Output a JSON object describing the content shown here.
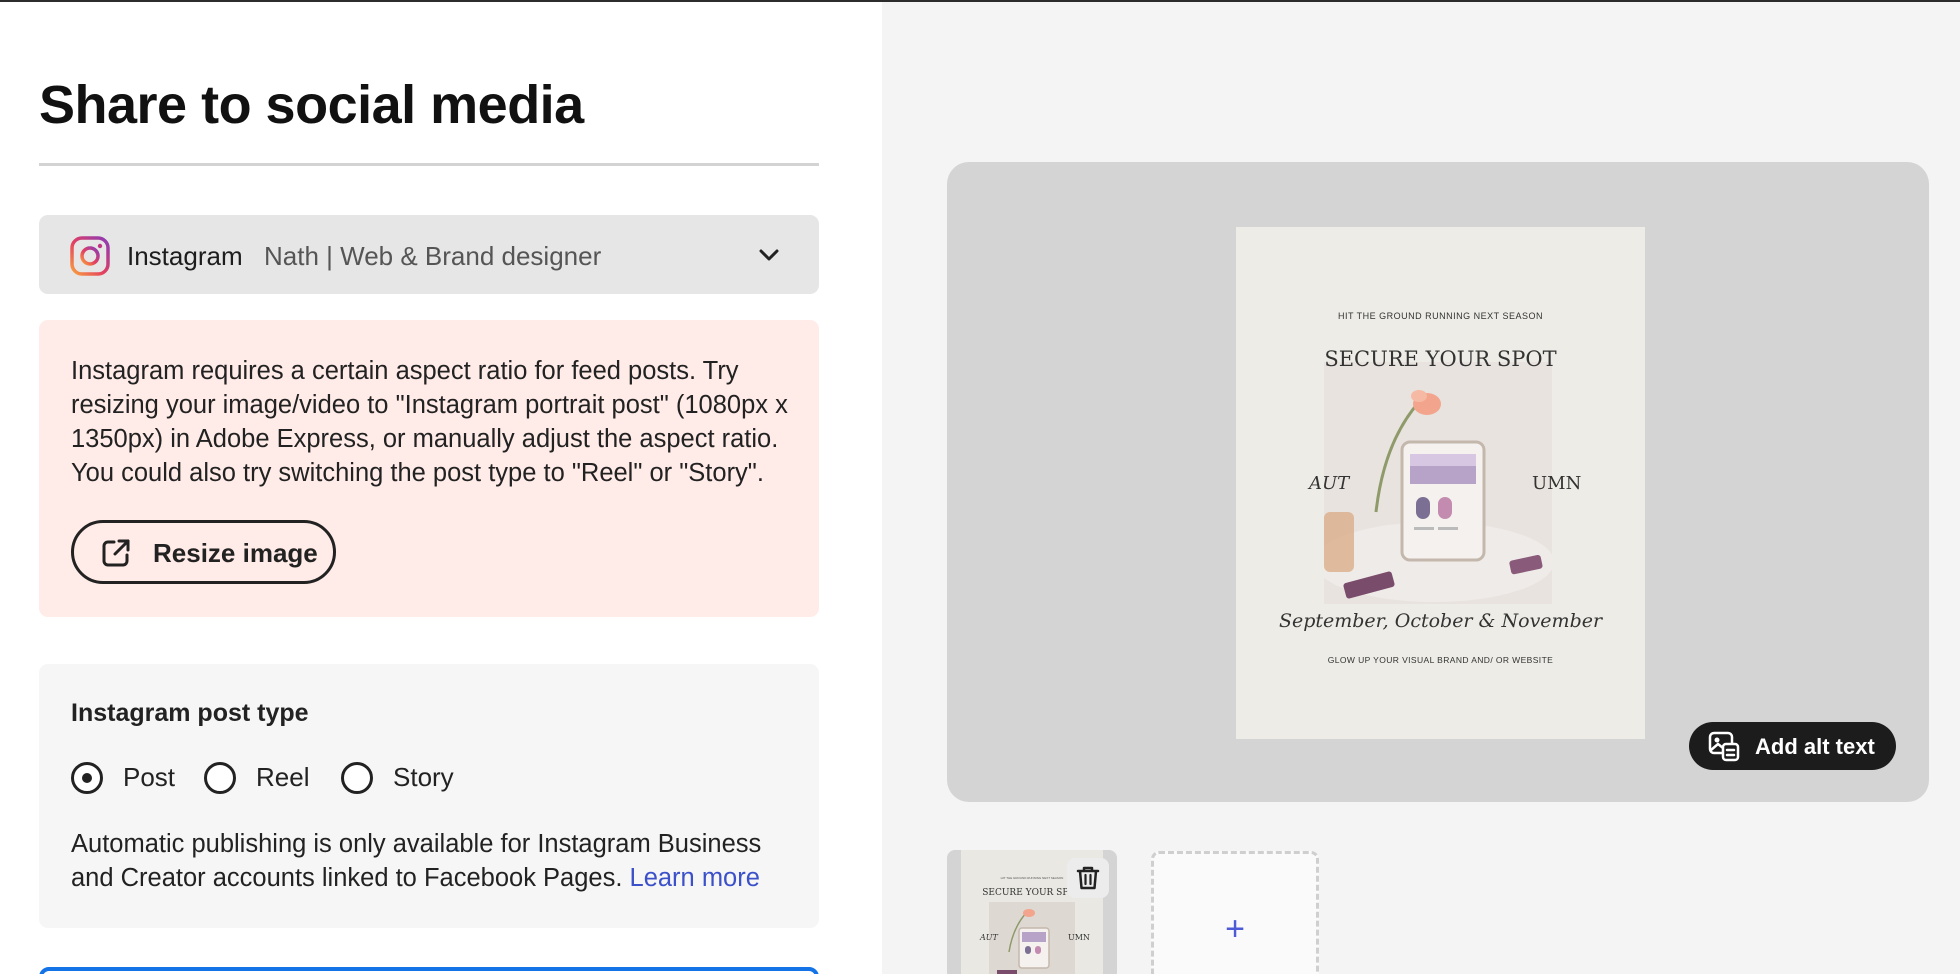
{
  "page": {
    "title": "Share to social media"
  },
  "account": {
    "platform": "Instagram",
    "name": "Nath | Web & Brand designer",
    "icon": "instagram-icon",
    "dropdown_icon": "chevron-down-icon"
  },
  "warning": {
    "message": "Instagram requires a certain aspect ratio for feed posts. Try resizing your image/video to \"Instagram portrait post\" (1080px x 1350px) in Adobe Express, or manually adjust the aspect ratio. You could also try switching the post type to \"Reel\" or \"Story\".",
    "resize_label": "Resize image",
    "resize_icon": "external-link-icon"
  },
  "post_type": {
    "heading": "Instagram post type",
    "options": [
      {
        "label": "Post",
        "selected": true
      },
      {
        "label": "Reel",
        "selected": false
      },
      {
        "label": "Story",
        "selected": false
      }
    ],
    "note": "Automatic publishing is only available for Instagram Business and Creator accounts linked to Facebook Pages.",
    "learn_more": "Learn more"
  },
  "preview": {
    "poster": {
      "top_line": "HIT THE GROUND RUNNING NEXT SEASON",
      "headline": "SECURE YOUR SPOT",
      "left_word": "AUT",
      "right_word": "UMN",
      "months": "September, October & November",
      "bottom_line": "GLOW UP YOUR VISUAL BRAND AND/ OR WEBSITE"
    },
    "alt_text_label": "Add alt text",
    "alt_text_icon": "alt-text-icon"
  },
  "thumbnails": {
    "delete_icon": "trash-icon",
    "add_label": "+"
  },
  "colors": {
    "warning_bg": "#ffebe7",
    "link": "#3b50c9",
    "accent_blue": "#1473e6",
    "preview_bg": "#d4d4d4",
    "panel_bg": "#f4f4f4"
  }
}
